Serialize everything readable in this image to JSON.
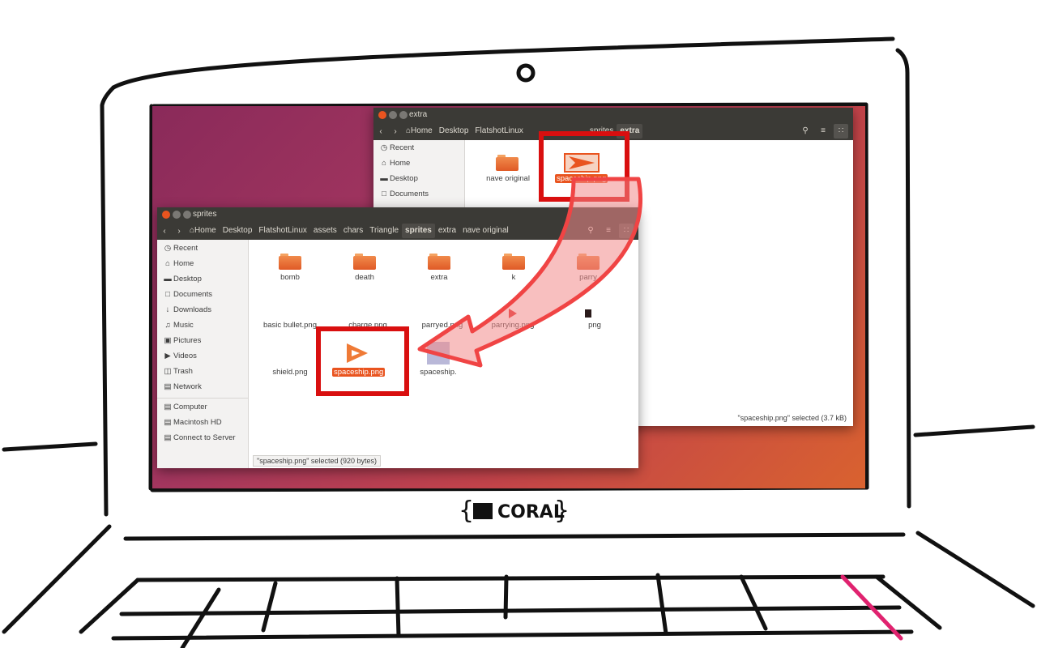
{
  "windows": {
    "extra": {
      "title": "extra",
      "breadcrumbs": [
        "Home",
        "Desktop",
        "FlatshotLinux",
        "sprites",
        "extra"
      ],
      "sidebar": [
        "Recent",
        "Home",
        "Desktop",
        "Documents"
      ],
      "files": [
        "nave original",
        "spaceship.png"
      ],
      "status": "\"spaceship.png\" selected  (3.7 kB)"
    },
    "sprites": {
      "title": "sprites",
      "breadcrumbs": [
        "Home",
        "Desktop",
        "FlatshotLinux",
        "assets",
        "chars",
        "Triangle",
        "sprites",
        "extra",
        "nave original"
      ],
      "sidebar": [
        "Recent",
        "Home",
        "Desktop",
        "Documents",
        "Downloads",
        "Music",
        "Pictures",
        "Videos",
        "Trash",
        "Network"
      ],
      "sidebar_devices": [
        "Computer",
        "Macintosh HD",
        "Connect to Server"
      ],
      "folders": [
        "bomb",
        "death",
        "extra",
        "k",
        "parry"
      ],
      "files_row2": [
        "basic bullet.png",
        "charge.png",
        "parryed.png",
        "parrying.png",
        "png"
      ],
      "files_row3": [
        "shield.png",
        "spaceship.png",
        "spaceship."
      ],
      "status": "\"spaceship.png\" selected  (920 bytes)"
    }
  },
  "brand": {
    "text": "CORAL"
  },
  "colors": {
    "accent": "#e9541f",
    "highlight": "#d90f0f",
    "arrow": "#f04444",
    "keyline": "#e0226f"
  },
  "icons": [
    "search-icon",
    "list-view-icon",
    "grid-view-icon",
    "back-icon",
    "forward-icon",
    "home-icon"
  ]
}
